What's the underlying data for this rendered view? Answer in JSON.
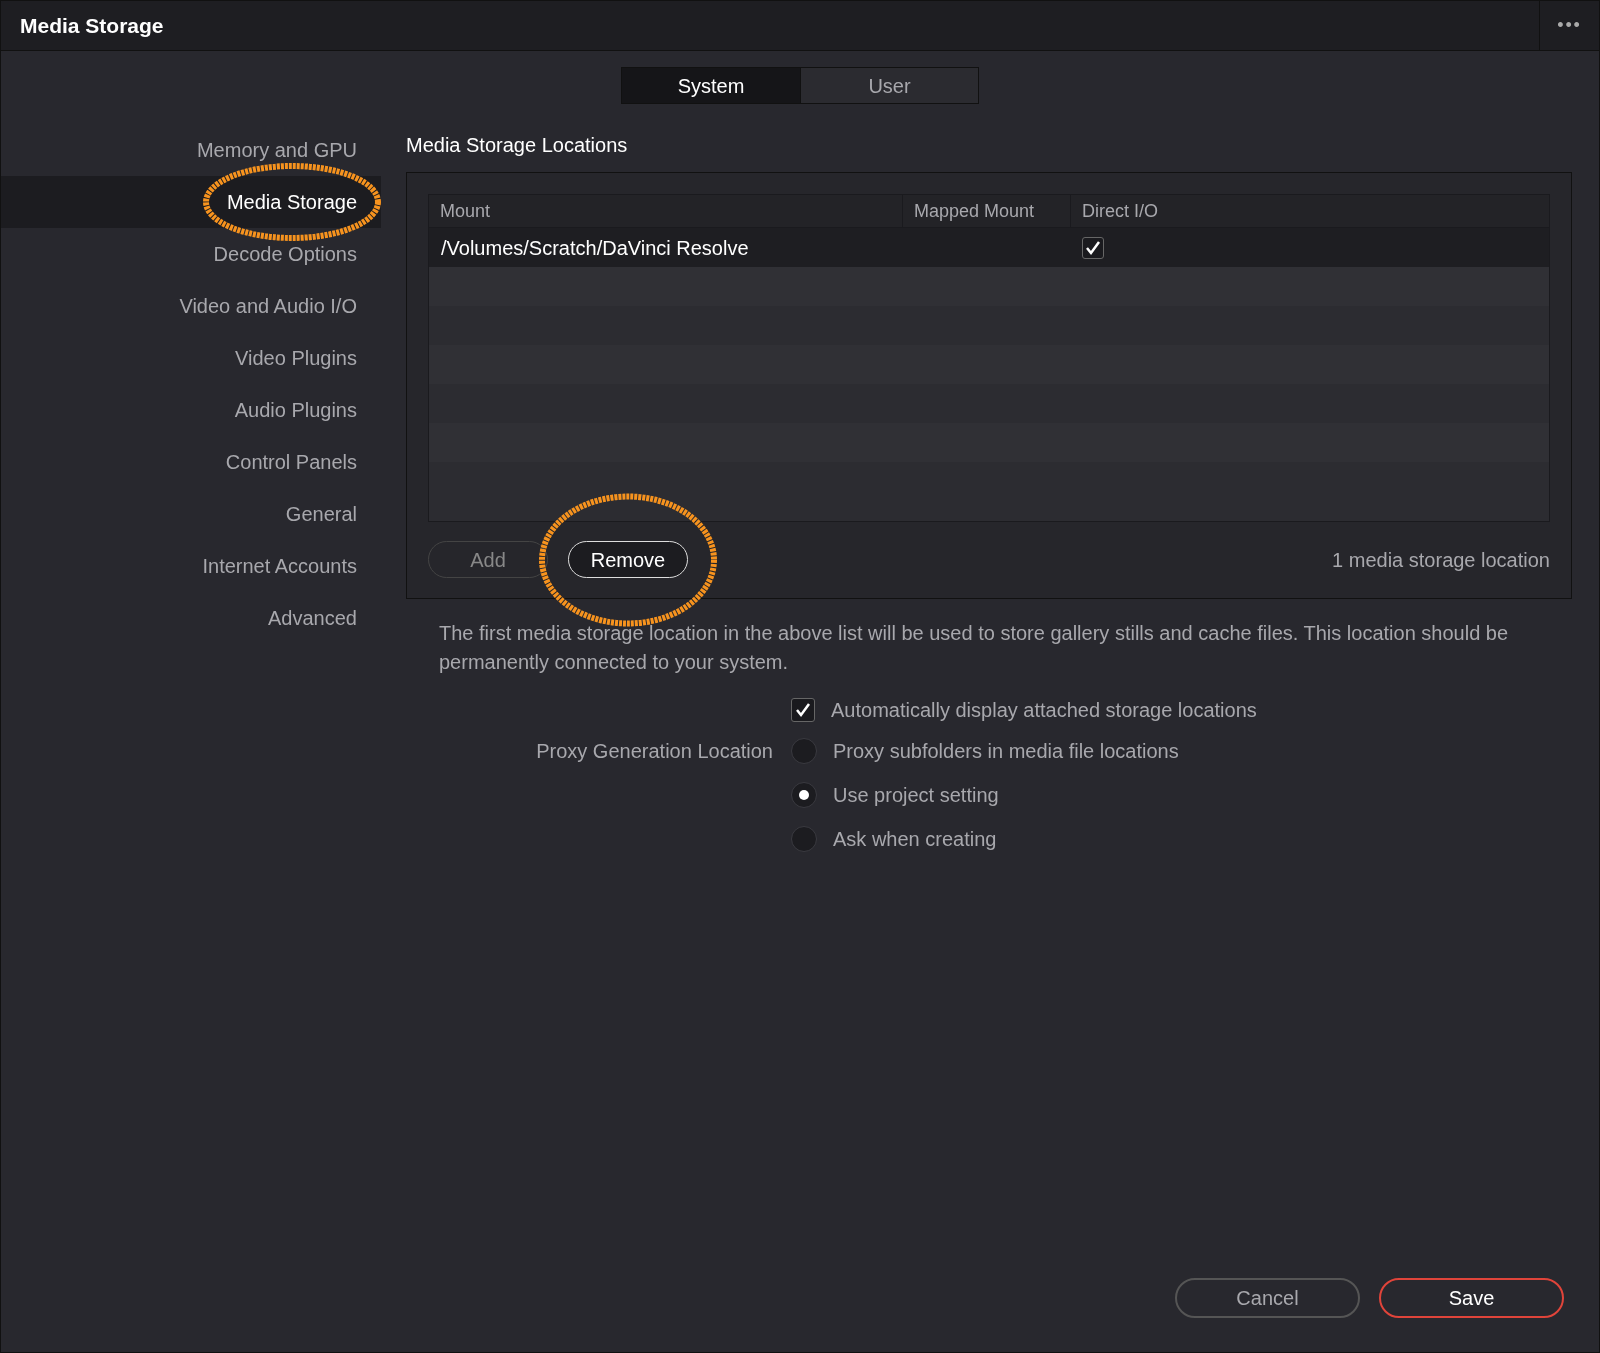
{
  "window": {
    "title": "Media Storage",
    "menu": "•••"
  },
  "tabs": [
    {
      "label": "System",
      "selected": true
    },
    {
      "label": "User",
      "selected": false
    }
  ],
  "sidebar": {
    "items": [
      {
        "label": "Memory and GPU",
        "selected": false,
        "highlighted": false
      },
      {
        "label": "Media Storage",
        "selected": true,
        "highlighted": true
      },
      {
        "label": "Decode Options",
        "selected": false,
        "highlighted": false
      },
      {
        "label": "Video and Audio I/O",
        "selected": false,
        "highlighted": false
      },
      {
        "label": "Video Plugins",
        "selected": false,
        "highlighted": false
      },
      {
        "label": "Audio Plugins",
        "selected": false,
        "highlighted": false
      },
      {
        "label": "Control Panels",
        "selected": false,
        "highlighted": false
      },
      {
        "label": "General",
        "selected": false,
        "highlighted": false
      },
      {
        "label": "Internet Accounts",
        "selected": false,
        "highlighted": false
      },
      {
        "label": "Advanced",
        "selected": false,
        "highlighted": false
      }
    ]
  },
  "section_title": "Media Storage Locations",
  "table": {
    "columns": [
      "Mount",
      "Mapped Mount",
      "Direct I/O"
    ],
    "rows": [
      {
        "mount": "/Volumes/Scratch/DaVinci Resolve",
        "direct_io": true,
        "selected": true
      }
    ]
  },
  "buttons": [
    {
      "label": "Add",
      "disabled": true,
      "highlighted": false
    },
    {
      "label": "Remove",
      "disabled": false,
      "highlighted": true
    }
  ],
  "count": "1 media storage location",
  "note": "The first media storage location in the above list will be used to store gallery stills and cache files. This location should be permanently connected to your system.",
  "auto_display": {
    "label": "Automatically display attached storage locations",
    "checked": true
  },
  "proxy": {
    "label": "Proxy Generation Location",
    "options": [
      {
        "label": "Proxy subfolders in media file locations",
        "selected": false
      },
      {
        "label": "Use project setting",
        "selected": true
      },
      {
        "label": "Ask when creating",
        "selected": false
      }
    ]
  },
  "footer": [
    {
      "label": "Cancel",
      "kind": "secondary"
    },
    {
      "label": "Save",
      "kind": "primary"
    }
  ]
}
